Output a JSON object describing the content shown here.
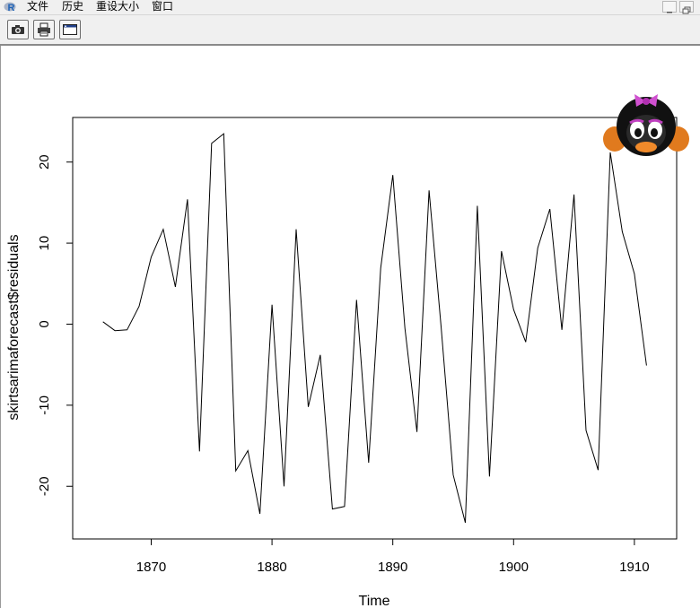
{
  "menubar": {
    "items": [
      "文件",
      "历史",
      "重设大小",
      "窗口"
    ]
  },
  "toolbar": {
    "icons": [
      "camera-icon",
      "printer-icon",
      "window-icon"
    ]
  },
  "chart_data": {
    "type": "line",
    "title": "",
    "xlabel": "Time",
    "ylabel": "skirtsarimaforecast$residuals",
    "xlim": [
      1863.5,
      1913.5
    ],
    "ylim": [
      -26.5,
      25.5
    ],
    "xticks": [
      1870,
      1880,
      1890,
      1900,
      1910
    ],
    "yticks": [
      -20,
      -10,
      0,
      10,
      20
    ],
    "x": [
      1866,
      1867,
      1868,
      1869,
      1870,
      1871,
      1872,
      1873,
      1874,
      1875,
      1876,
      1877,
      1878,
      1879,
      1880,
      1881,
      1882,
      1883,
      1884,
      1885,
      1886,
      1887,
      1888,
      1889,
      1890,
      1891,
      1892,
      1893,
      1894,
      1895,
      1896,
      1897,
      1898,
      1899,
      1900,
      1901,
      1902,
      1903,
      1904,
      1905,
      1906,
      1907,
      1908,
      1909,
      1910,
      1911
    ],
    "series": [
      {
        "values": [
          0.3,
          -0.8,
          -0.7,
          2.2,
          8.3,
          11.7,
          4.6,
          15.4,
          -15.7,
          22.3,
          23.5,
          -18.1,
          -15.6,
          -23.4,
          2.4,
          -20,
          11.7,
          -10.2,
          -3.8,
          -22.8,
          -22.5,
          3,
          -17.1,
          6.9,
          18.4,
          -0.5,
          -13.3,
          16.5,
          -0.3,
          -18.6,
          -24.5,
          14.6,
          -18.8,
          9,
          1.8,
          -2.2,
          9.4,
          14.2,
          -0.7,
          16,
          -13.1,
          -18,
          21.2,
          11.4,
          6.2,
          -5.1
        ]
      }
    ],
    "grid": false,
    "legend": "none"
  }
}
